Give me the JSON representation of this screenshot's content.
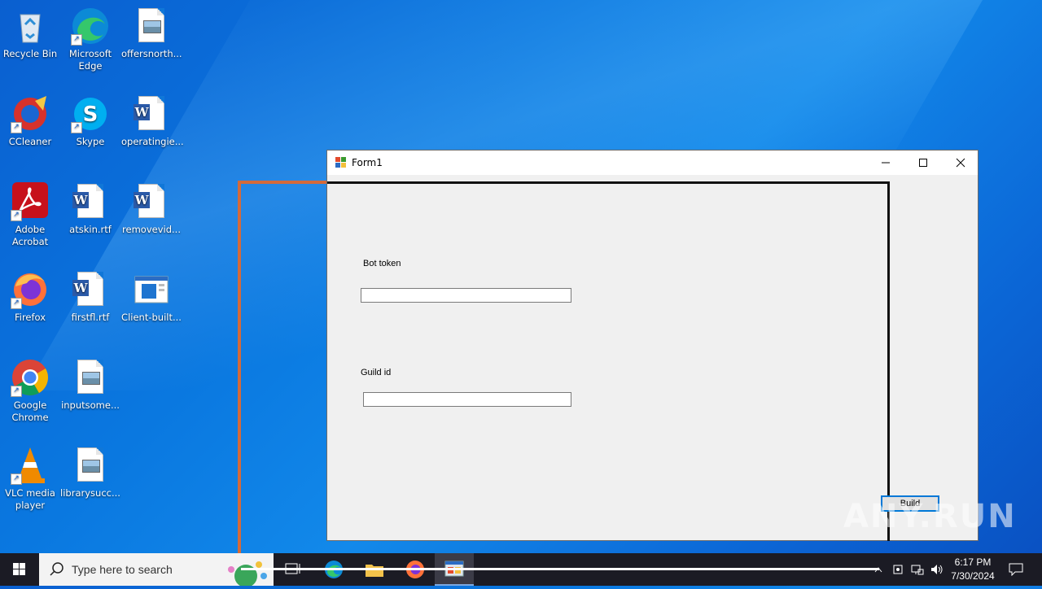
{
  "desktop": {
    "icons": [
      {
        "label": "Recycle Bin"
      },
      {
        "label": "Microsoft Edge"
      },
      {
        "label": "offersnorth..."
      },
      {
        "label": "CCleaner"
      },
      {
        "label": "Skype"
      },
      {
        "label": "operatingie..."
      },
      {
        "label": "Adobe Acrobat"
      },
      {
        "label": "atskin.rtf"
      },
      {
        "label": "removevid..."
      },
      {
        "label": "Firefox"
      },
      {
        "label": "firstfl.rtf"
      },
      {
        "label": "Client-built..."
      },
      {
        "label": "Google Chrome"
      },
      {
        "label": "inputsome..."
      },
      {
        "label": "VLC media player"
      },
      {
        "label": "librarysucc..."
      }
    ]
  },
  "window": {
    "title": "Form1",
    "bot_token_label": "Bot token",
    "bot_token_value": "",
    "guild_id_label": "Guild id",
    "guild_id_value": "",
    "build_button": "Build",
    "controls": {
      "minimize": "—",
      "maximize": "☐",
      "close": "✕"
    }
  },
  "taskbar": {
    "search_placeholder": "Type here to search",
    "time": "6:17 PM",
    "date": "7/30/2024"
  },
  "watermark": "ANY.RUN"
}
